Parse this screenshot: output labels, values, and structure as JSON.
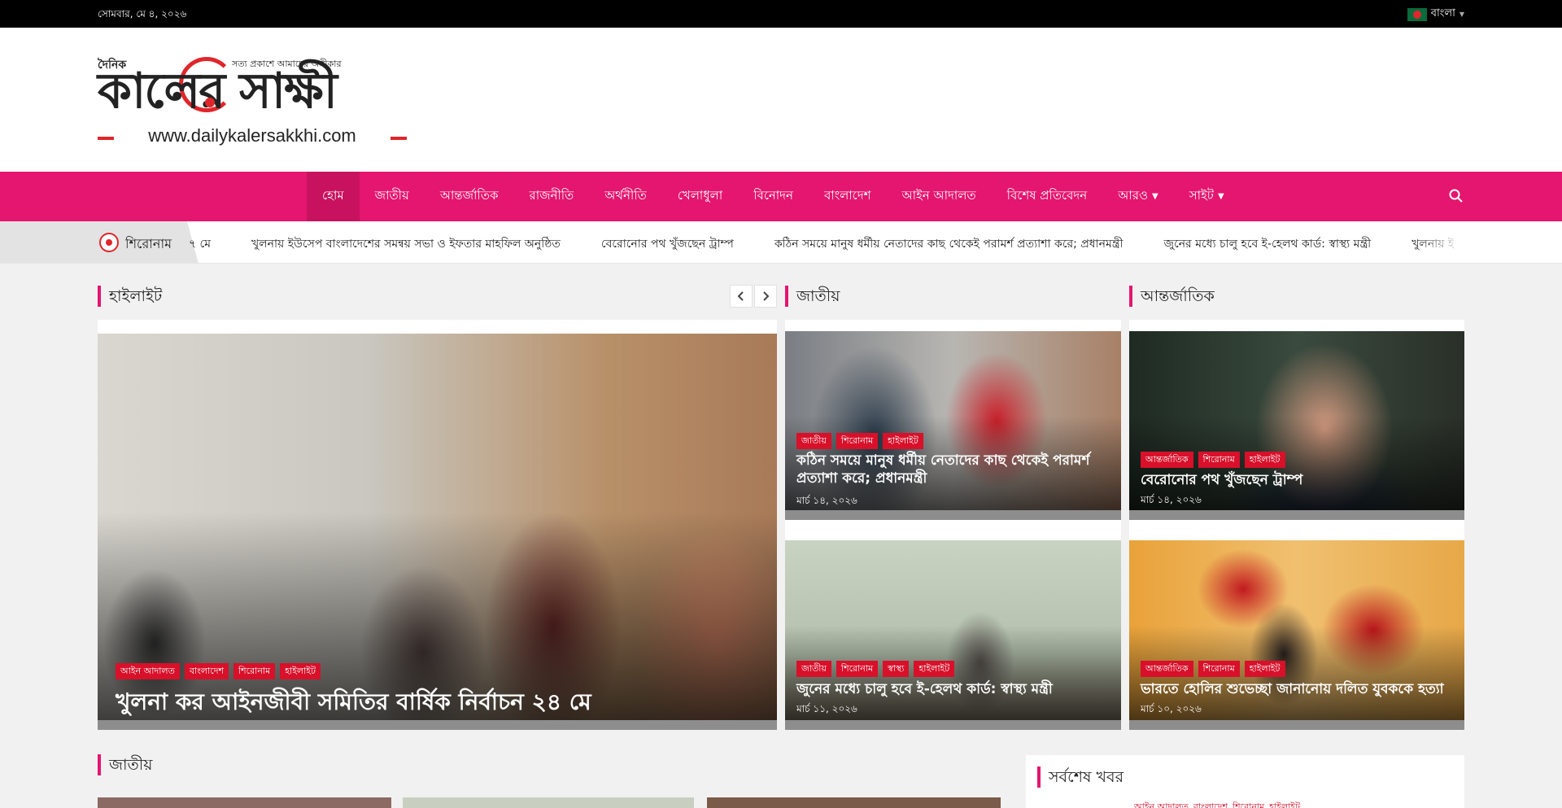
{
  "topbar": {
    "date": "সোমবার, মে ৪, ২০২৬",
    "language": "বাংলা"
  },
  "logo": {
    "prefix": "দৈনিক",
    "name": "কালের সাক্ষী",
    "tagline": "সত্য প্রকাশে আমাদের অঙ্গীকার",
    "url": "www.dailykalersakkhi.com"
  },
  "nav": {
    "items": [
      {
        "label": "হোম",
        "active": true
      },
      {
        "label": "জাতীয়"
      },
      {
        "label": "আন্তর্জাতিক"
      },
      {
        "label": "রাজনীতি"
      },
      {
        "label": "অর্থনীতি"
      },
      {
        "label": "খেলাধুলা"
      },
      {
        "label": "বিনোদন"
      },
      {
        "label": "বাংলাদেশ"
      },
      {
        "label": "আইন আদালত"
      },
      {
        "label": "বিশেষ প্রতিবেদন"
      },
      {
        "label": "আরও",
        "dropdown": true
      },
      {
        "label": "সাইট",
        "dropdown": true
      }
    ],
    "search_icon": "search-icon"
  },
  "ticker": {
    "label": "শিরোনাম",
    "items": [
      "৭ মে",
      "খুলনায় ইউসেপ বাংলাদেশের সমন্বয় সভা ও ইফতার মাহফিল অনুষ্ঠিত",
      "বেরোনোর পথ খুঁজছেন ট্রাম্প",
      "কঠিন সময়ে মানুষ ধর্মীয় নেতাদের কাছ থেকেই পরামর্শ প্রত্যাশা করে; প্রধানমন্ত্রী",
      "জুনের মধ্যে চালু হবে ই-হেলথ কার্ড: স্বাস্থ্য মন্ত্রী",
      "খুলনায় ই"
    ]
  },
  "sections": {
    "highlight": {
      "title": "হাইলাইট",
      "main": {
        "tags": [
          "আইন আদালত",
          "বাংলাদেশ",
          "শিরোনাম",
          "হাইলাইট"
        ],
        "headline": "খুলনা কর আইনজীবী সমিতির বার্ষিক নির্বাচন ২৪ মে"
      }
    },
    "national": {
      "title": "জাতীয়",
      "cards": [
        {
          "tags": [
            "জাতীয়",
            "শিরোনাম",
            "হাইলাইট"
          ],
          "headline": "কঠিন সময়ে মানুষ ধর্মীয় নেতাদের কাছ থেকেই পরামর্শ প্রত্যাশা করে; প্রধানমন্ত্রী",
          "date": "মার্চ ১৪, ২০২৬"
        },
        {
          "tags": [
            "জাতীয়",
            "শিরোনাম",
            "স্বাস্থ্য",
            "হাইলাইট"
          ],
          "headline": "জুনের মধ্যে চালু হবে ই-হেলথ কার্ড: স্বাস্থ্য মন্ত্রী",
          "date": "মার্চ ১১, ২০২৬"
        }
      ]
    },
    "international": {
      "title": "আন্তর্জাতিক",
      "cards": [
        {
          "tags": [
            "আন্তর্জাতিক",
            "শিরোনাম",
            "হাইলাইট"
          ],
          "headline": "বেরোনোর পথ খুঁজছেন ট্রাম্প",
          "date": "মার্চ ১৪, ২০২৬"
        },
        {
          "tags": [
            "আন্তর্জাতিক",
            "শিরোনাম",
            "হাইলাইট"
          ],
          "headline": "ভারতে হোলির শুভেচ্ছা জানানোয় দলিত যুবককে হত্যা",
          "date": "মার্চ ১০, ২০২৬"
        }
      ]
    },
    "national2": {
      "title": "জাতীয়"
    },
    "latest": {
      "title": "সর্বশেষ খবর",
      "tags": [
        "আইন আদালত",
        "বাংলাদেশ",
        "শিরোনাম",
        "হাইলাইট"
      ]
    }
  },
  "colors": {
    "brand": "#e4166f",
    "tag": "#d8102a",
    "accent_red": "#e0262b"
  }
}
